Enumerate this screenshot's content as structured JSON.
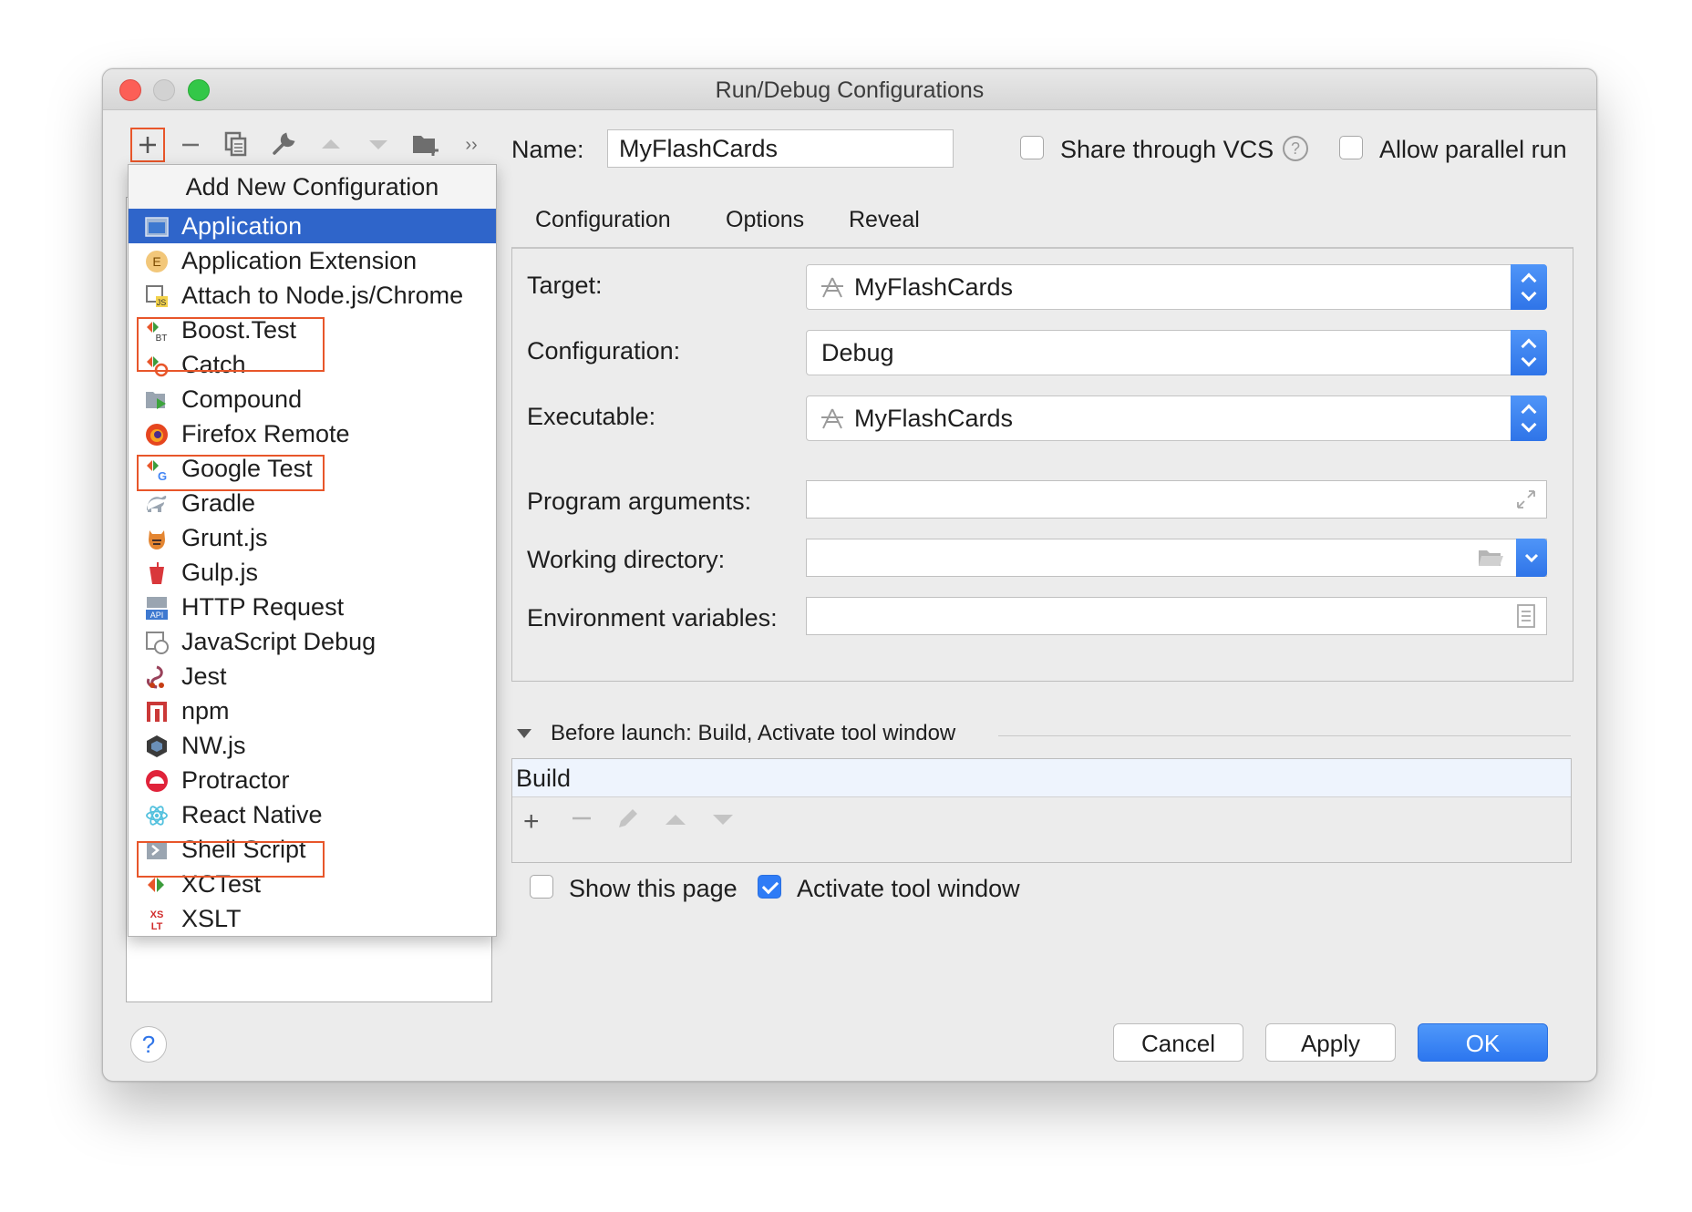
{
  "window": {
    "title": "Run/Debug Configurations"
  },
  "toolbar": {
    "items": [
      "add-icon",
      "remove-icon",
      "copy-icon",
      "wrench-icon",
      "move-up-icon",
      "move-down-icon",
      "folder-add-icon",
      "more-icon"
    ]
  },
  "popup": {
    "header": "Add New Configuration",
    "items": [
      {
        "label": "Application",
        "icon": "application-icon",
        "selected": true
      },
      {
        "label": "Application Extension",
        "icon": "application-extension-icon"
      },
      {
        "label": "Attach to Node.js/Chrome",
        "icon": "attach-node-icon"
      },
      {
        "label": "Boost.Test",
        "icon": "boost-test-icon"
      },
      {
        "label": "Catch",
        "icon": "catch-icon"
      },
      {
        "label": "Compound",
        "icon": "compound-icon"
      },
      {
        "label": "Firefox Remote",
        "icon": "firefox-icon"
      },
      {
        "label": "Google Test",
        "icon": "google-test-icon"
      },
      {
        "label": "Gradle",
        "icon": "gradle-icon"
      },
      {
        "label": "Grunt.js",
        "icon": "grunt-icon"
      },
      {
        "label": "Gulp.js",
        "icon": "gulp-icon"
      },
      {
        "label": "HTTP Request",
        "icon": "http-request-icon"
      },
      {
        "label": "JavaScript Debug",
        "icon": "javascript-debug-icon"
      },
      {
        "label": "Jest",
        "icon": "jest-icon"
      },
      {
        "label": "npm",
        "icon": "npm-icon"
      },
      {
        "label": "NW.js",
        "icon": "nwjs-icon"
      },
      {
        "label": "Protractor",
        "icon": "protractor-icon"
      },
      {
        "label": "React Native",
        "icon": "react-icon"
      },
      {
        "label": "Shell Script",
        "icon": "shell-script-icon"
      },
      {
        "label": "XCTest",
        "icon": "xctest-icon"
      },
      {
        "label": "XSLT",
        "icon": "xslt-icon"
      }
    ]
  },
  "name_field": {
    "label": "Name:",
    "value": "MyFlashCards"
  },
  "share_vcs": {
    "label": "Share through VCS",
    "checked": false
  },
  "allow_parallel": {
    "label": "Allow parallel run",
    "checked": false
  },
  "tabs": [
    "Configuration",
    "Options",
    "Reveal"
  ],
  "form": {
    "target_label": "Target:",
    "target_value": "MyFlashCards",
    "configuration_label": "Configuration:",
    "configuration_value": "Debug",
    "executable_label": "Executable:",
    "executable_value": "MyFlashCards",
    "program_args_label": "Program arguments:",
    "working_dir_label": "Working directory:",
    "env_vars_label": "Environment variables:"
  },
  "before_launch": {
    "title": "Before launch: Build, Activate tool window",
    "tasks": [
      "Build"
    ]
  },
  "show_page": {
    "label": "Show this page",
    "checked": false
  },
  "activate_tool": {
    "label": "Activate tool window",
    "checked": true
  },
  "buttons": {
    "cancel": "Cancel",
    "apply": "Apply",
    "ok": "OK",
    "help": "?"
  },
  "colors": {
    "accent": "#2f74e8",
    "highlight": "#e8562a",
    "selection": "#2f65ca"
  }
}
